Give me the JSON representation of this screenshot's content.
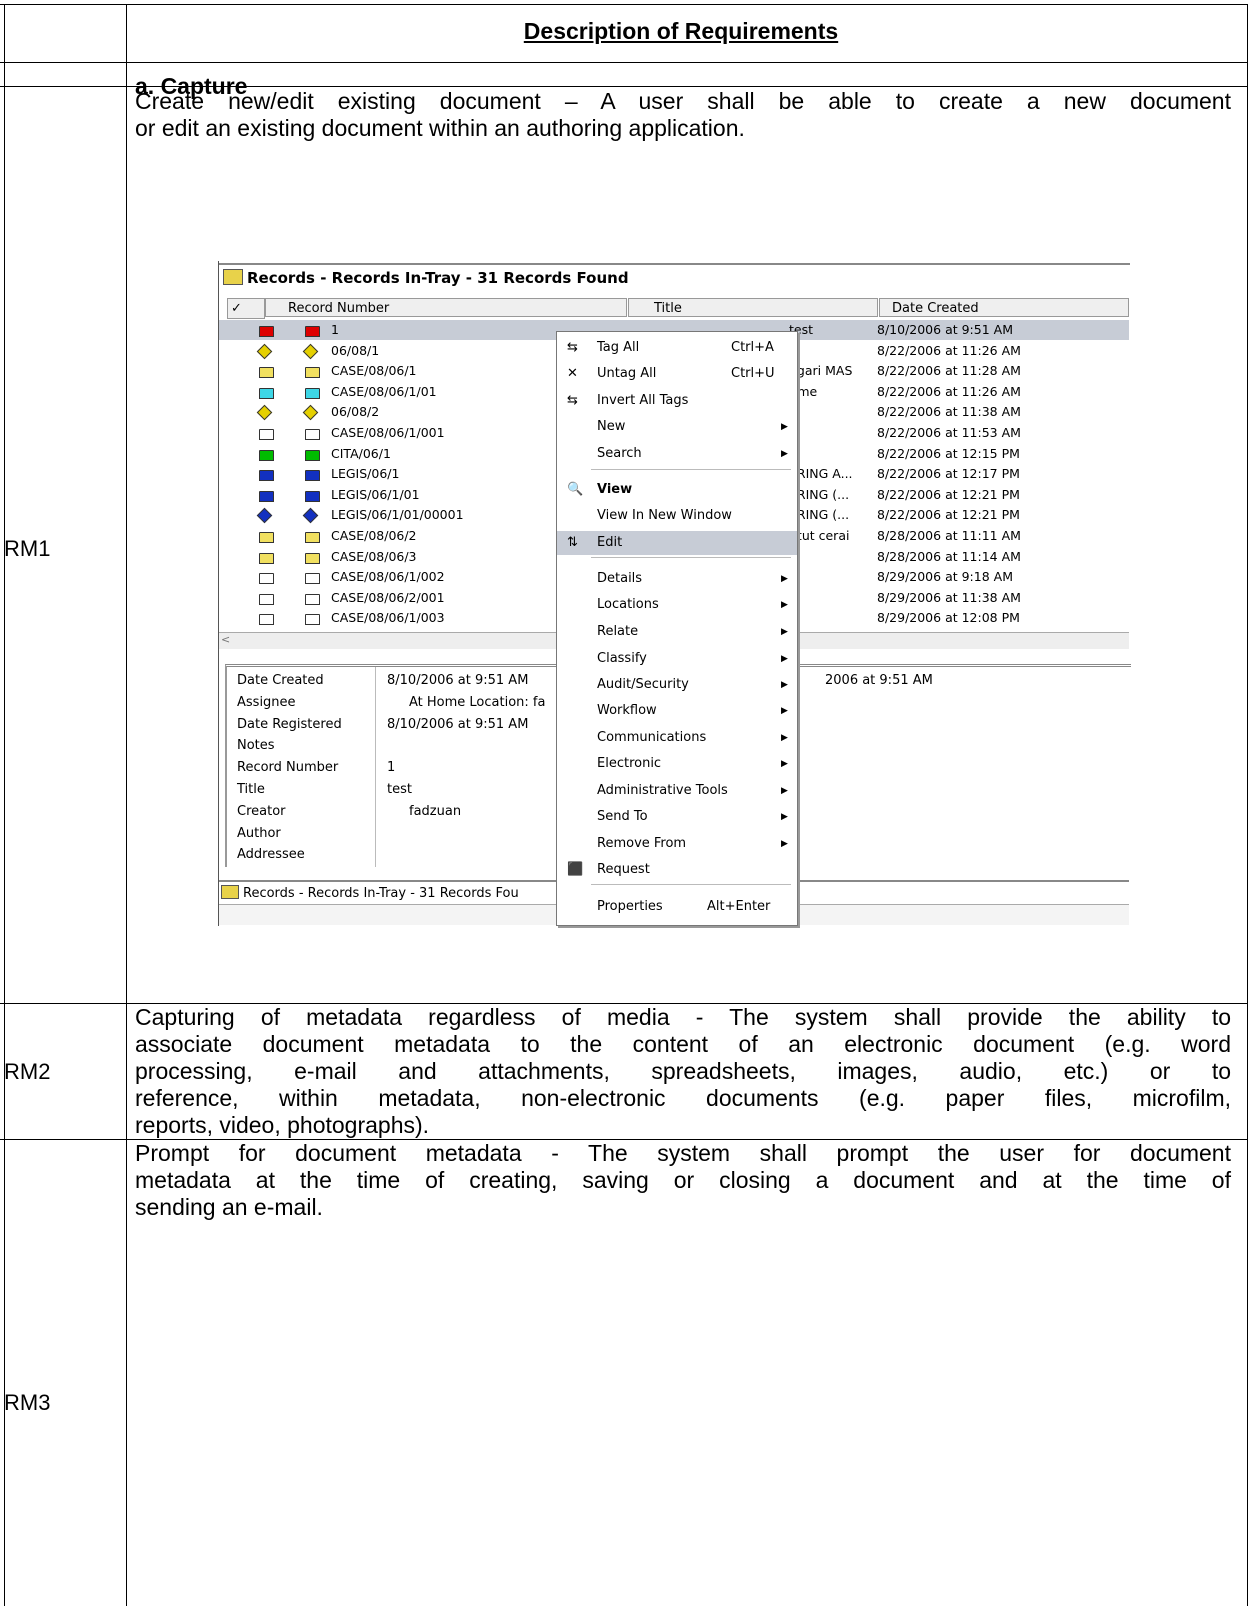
{
  "table": {
    "header": "Description of Requirements",
    "section": "a. Capture",
    "rows": [
      {
        "id": "RM1",
        "lines": [
          "Create new/edit existing document – A user shall be able to create a new document",
          "or edit an existing document within an authoring application."
        ]
      },
      {
        "id": "RM2",
        "lines": [
          "Capturing of metadata regardless of media - The system shall provide the ability to",
          "associate document metadata to the content of an electronic document (e.g. word",
          "processing, e-mail and attachments, spreadsheets, images, audio, etc.) or to",
          "reference, within metadata, non-electronic documents (e.g. paper files, microfilm,",
          "reports, video, photographs)."
        ]
      },
      {
        "id": "RM3",
        "lines": [
          "Prompt for document metadata - The system shall prompt the user for document",
          "metadata at the time of creating, saving or closing a document and at the time of",
          "sending an e-mail."
        ]
      }
    ]
  },
  "screenshot": {
    "title": "Records - Records In-Tray - 31 Records Found",
    "columns": {
      "record_number": "Record Number",
      "title": "Title",
      "date_created": "Date Created"
    },
    "records": [
      {
        "number": "1",
        "title": "test",
        "date": "8/10/2006 at 9:51 AM"
      },
      {
        "number": "06/08/1",
        "title": "",
        "date": "8/22/2006 at 11:26 AM"
      },
      {
        "number": "CASE/08/06/1",
        "title": "ugari MAS",
        "date": "8/22/2006 at 11:28 AM"
      },
      {
        "number": "CASE/08/06/1/01",
        "title": "time",
        "date": "8/22/2006 at 11:26 AM"
      },
      {
        "number": "06/08/2",
        "title": "",
        "date": "8/22/2006 at 11:38 AM"
      },
      {
        "number": "CASE/08/06/1/001",
        "title": "",
        "date": "8/22/2006 at 11:53 AM"
      },
      {
        "number": "CITA/06/1",
        "title": "",
        "date": "8/22/2006 at 12:15 PM"
      },
      {
        "number": "LEGIS/06/1",
        "title": "ERING A...",
        "date": "8/22/2006 at 12:17 PM"
      },
      {
        "number": "LEGIS/06/1/01",
        "title": "ERING (...",
        "date": "8/22/2006 at 12:21 PM"
      },
      {
        "number": "LEGIS/06/1/01/00001",
        "title": "ERING (...",
        "date": "8/22/2006 at 12:21 PM"
      },
      {
        "number": "CASE/08/06/2",
        "title": "ntut cerai",
        "date": "8/28/2006 at 11:11 AM"
      },
      {
        "number": "CASE/08/06/3",
        "title": "",
        "date": "8/28/2006 at 11:14 AM"
      },
      {
        "number": "CASE/08/06/1/002",
        "title": "",
        "date": "8/29/2006 at 9:18 AM"
      },
      {
        "number": "CASE/08/06/2/001",
        "title": "",
        "date": "8/29/2006 at 11:38 AM"
      },
      {
        "number": "CASE/08/06/1/003",
        "title": "",
        "date": "8/29/2006 at 12:08 PM"
      }
    ],
    "details": [
      {
        "label": "Date Created",
        "value": "8/10/2006 at 9:51 AM"
      },
      {
        "label": "Assignee",
        "value": "At Home Location: fa"
      },
      {
        "label": "Date Registered",
        "value": "8/10/2006 at 9:51 AM"
      },
      {
        "label": "Notes",
        "value": ""
      },
      {
        "label": "Record Number",
        "value": "1"
      },
      {
        "label": "Title",
        "value": "test"
      },
      {
        "label": "Creator",
        "value": "fadzuan"
      },
      {
        "label": "Author",
        "value": ""
      },
      {
        "label": "Addressee",
        "value": ""
      }
    ],
    "detail_extra": "2006 at 9:51 AM",
    "status": "Records - Records In-Tray - 31 Records Fou"
  },
  "menu": {
    "items": [
      {
        "label": "Tag All",
        "shortcut": "Ctrl+A"
      },
      {
        "label": "Untag All",
        "shortcut": "Ctrl+U"
      },
      {
        "label": "Invert All Tags",
        "shortcut": ""
      },
      {
        "label": "New",
        "shortcut": ""
      },
      {
        "label": "Search",
        "shortcut": ""
      },
      {
        "label": "View",
        "shortcut": ""
      },
      {
        "label": "View In New Window",
        "shortcut": ""
      },
      {
        "label": "Edit",
        "shortcut": ""
      },
      {
        "label": "Details",
        "shortcut": ""
      },
      {
        "label": "Locations",
        "shortcut": ""
      },
      {
        "label": "Relate",
        "shortcut": ""
      },
      {
        "label": "Classify",
        "shortcut": ""
      },
      {
        "label": "Audit/Security",
        "shortcut": ""
      },
      {
        "label": "Workflow",
        "shortcut": ""
      },
      {
        "label": "Communications",
        "shortcut": ""
      },
      {
        "label": "Electronic",
        "shortcut": ""
      },
      {
        "label": "Administrative Tools",
        "shortcut": ""
      },
      {
        "label": "Send To",
        "shortcut": ""
      },
      {
        "label": "Remove From",
        "shortcut": ""
      },
      {
        "label": "Request",
        "shortcut": ""
      },
      {
        "label": "Properties",
        "shortcut": "Alt+Enter"
      }
    ]
  }
}
